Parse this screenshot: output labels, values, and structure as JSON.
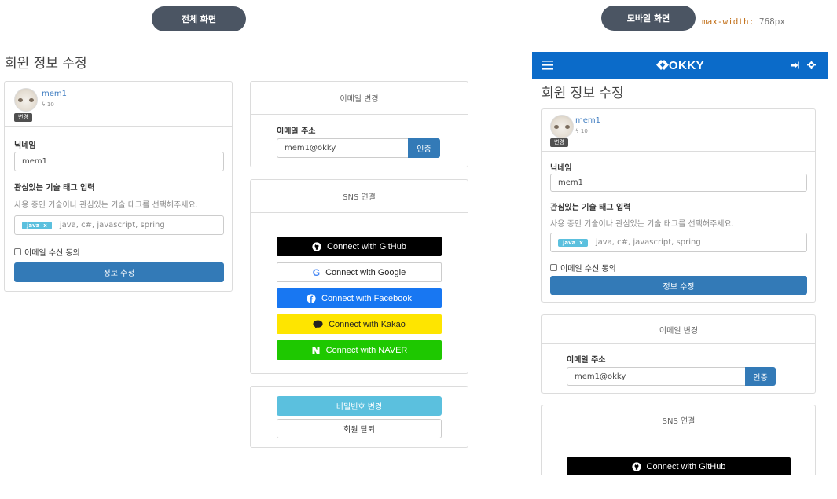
{
  "labels": {
    "desktop_view": "전체 화면",
    "mobile_view": "모바일 화면",
    "media_key": "max-width:",
    "media_value": "768px"
  },
  "page": {
    "title": "회원 정보 수정"
  },
  "profile": {
    "username": "mem1",
    "points": "10",
    "change_badge": "변경",
    "nickname_label": "닉네임",
    "nickname_value": "mem1",
    "tags_label": "관심있는 기술 태그 입력",
    "tags_hint": "사용 중인 기술이나 관심있는 기술 태그를 선택해주세요.",
    "tag_chip": "java",
    "tag_chip_remove": "x",
    "tags_placeholder": "java, c#, javascript, spring",
    "email_consent": "이메일 수신 동의",
    "submit": "정보 수정"
  },
  "email": {
    "header": "이메일 변경",
    "label": "이메일 주소",
    "value": "mem1@okky",
    "verify": "인증"
  },
  "sns": {
    "header": "SNS 연결",
    "buttons": [
      {
        "label": "Connect with GitHub",
        "icon": "github-icon"
      },
      {
        "label": "Connect with Google",
        "icon": "google-icon"
      },
      {
        "label": "Connect with Facebook",
        "icon": "facebook-icon"
      },
      {
        "label": "Connect with Kakao",
        "icon": "kakao-icon"
      },
      {
        "label": "Connect with NAVER",
        "icon": "naver-icon"
      }
    ]
  },
  "account": {
    "change_password": "비밀번호 변경",
    "withdraw": "회원 탈퇴"
  },
  "mobile_nav": {
    "logo": "OKKY",
    "icons": [
      "hamburger-icon",
      "logout-icon",
      "gear-icon"
    ]
  },
  "colors": {
    "primary": "#337ab7",
    "info": "#5bc0de",
    "nav": "#0b6bc9",
    "github": "#000000",
    "facebook": "#1877f2",
    "kakao": "#fee500",
    "naver": "#1ec800"
  }
}
